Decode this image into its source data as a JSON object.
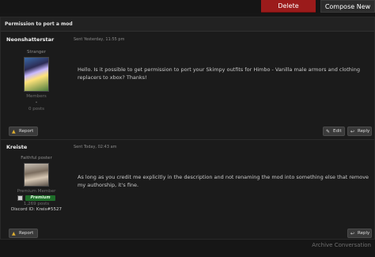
{
  "toolbar": {
    "delete_label": "Delete",
    "compose_label": "Compose New"
  },
  "thread": {
    "title": "Permission to port a mod"
  },
  "posts": [
    {
      "author": "Neonshatterstar",
      "sent": "Sent Yesterday, 11:55 pm",
      "rank": "Stranger",
      "group": "Members",
      "bullet": "•",
      "posts": "0 posts",
      "message": "Hello. Is it possible to get permission to port your Skimpy outfits for Himbo - Vanilla male armors and clothing replacers to xbox?  Thanks!",
      "actions": {
        "report": "Report",
        "edit": "Edit",
        "reply": "Reply"
      }
    },
    {
      "author": "Kreiste",
      "sent": "Sent Today, 02:43 am",
      "rank": "Faithful poster",
      "group": "Premium Member",
      "badge": "Premium",
      "posts": "1,269 posts",
      "discord": "Discord ID: Kreis#5527",
      "message": "As long as you credit me explicitly in the description and not renaming the mod into something else that remove my authorship, it's fine.",
      "actions": {
        "report": "Report",
        "reply": "Reply"
      }
    }
  ],
  "footer": {
    "archive": "Archive Conversation"
  },
  "icons": {
    "report": "warning-icon",
    "edit": "speech-bubble-icon",
    "reply": "reply-bubble-icon"
  },
  "colors": {
    "delete": "#9b1b1b",
    "premium_badge": "#1f6e2a",
    "background": "#161616"
  }
}
